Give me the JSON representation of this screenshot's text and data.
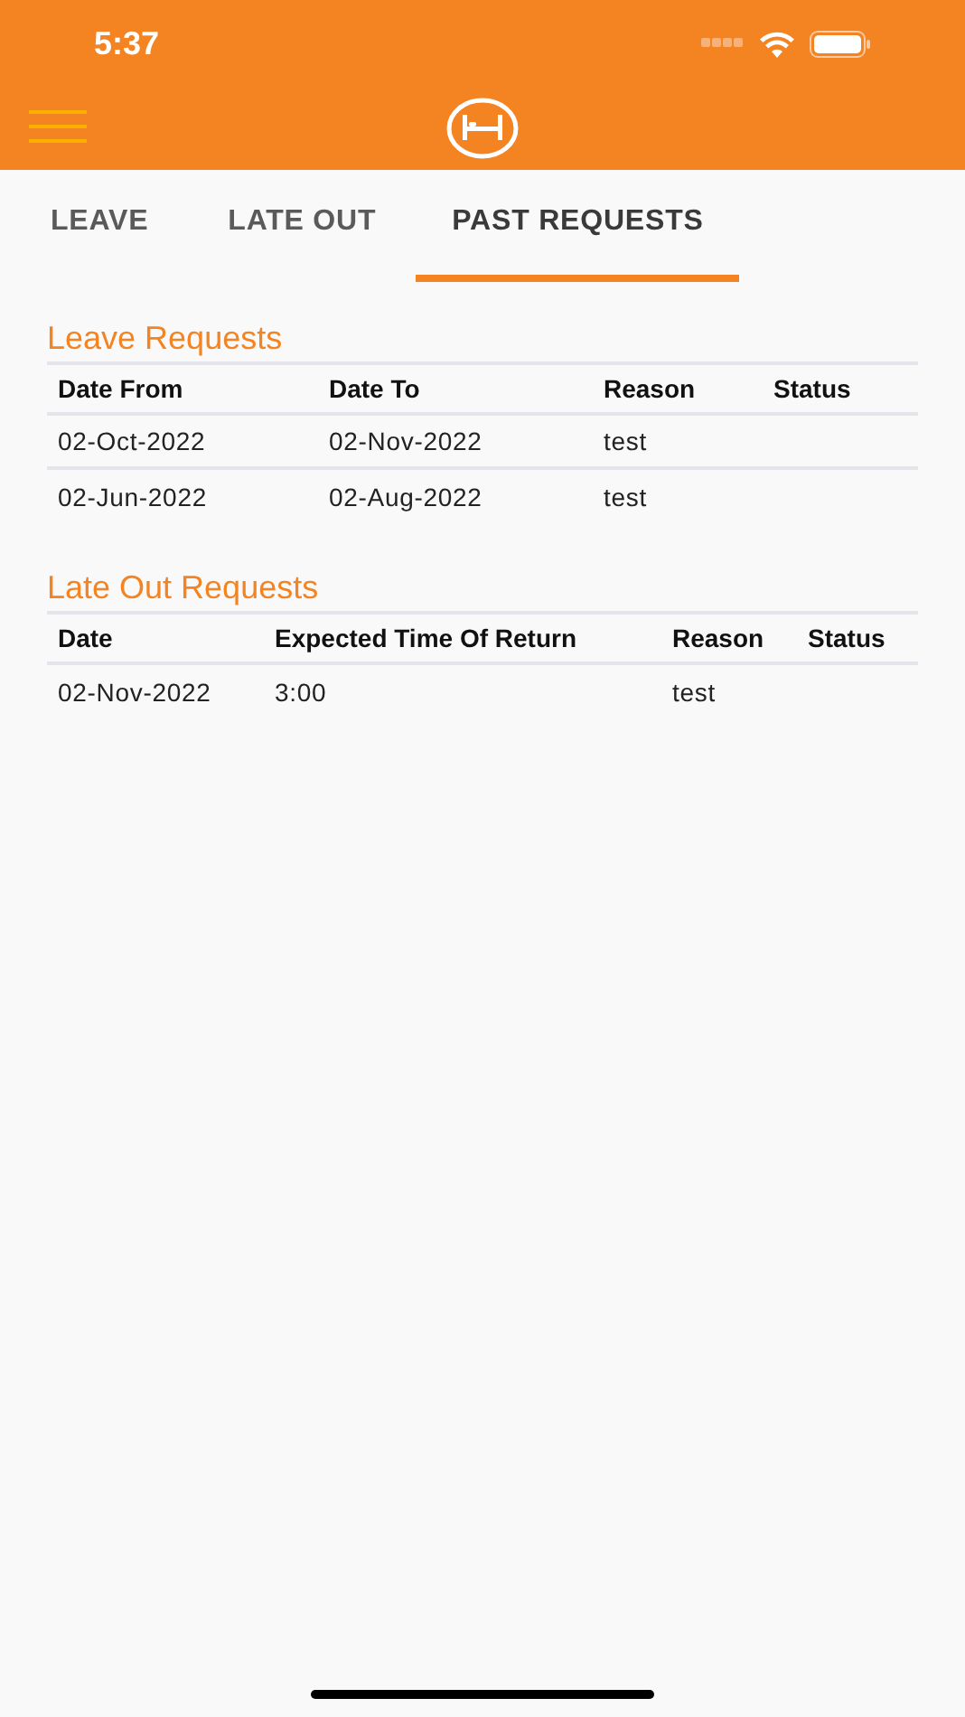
{
  "status_bar": {
    "time": "5:37"
  },
  "tabs": [
    {
      "label": "LEAVE",
      "selected": false
    },
    {
      "label": "LATE OUT",
      "selected": false
    },
    {
      "label": "PAST REQUESTS",
      "selected": true
    }
  ],
  "sections": [
    {
      "title": "Leave Requests",
      "columns": [
        "Date From",
        "Date To",
        "Reason",
        "Status"
      ],
      "rows": [
        [
          "02-Oct-2022",
          "02-Nov-2022",
          "test",
          ""
        ],
        [
          "02-Jun-2022",
          "02-Aug-2022",
          "test",
          ""
        ]
      ]
    },
    {
      "title": "Late Out Requests",
      "columns": [
        "Date",
        "Expected Time Of Return",
        "Reason",
        "Status"
      ],
      "rows": [
        [
          "02-Nov-2022",
          "3:00",
          "test",
          ""
        ]
      ]
    }
  ]
}
